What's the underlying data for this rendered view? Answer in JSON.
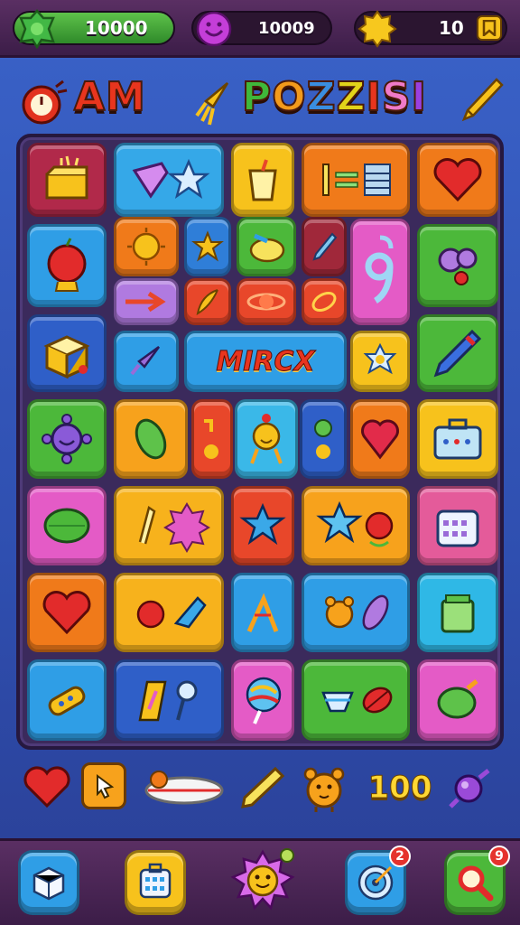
{
  "resources": {
    "gems": {
      "value": "10000",
      "icon": "green-gem-icon",
      "color": "#3fae3a"
    },
    "lives": {
      "value": "10009",
      "icon": "purple-smiley-icon",
      "color": "#b03fd0"
    },
    "coins": {
      "value": "10",
      "icon": "gold-star-coin-icon",
      "color": "#f5c518"
    }
  },
  "title": {
    "word1": "AM",
    "word2": "POZZISI",
    "word1_color": "#e8351e",
    "word2_colors": [
      "#3fb83a",
      "#f29a1b",
      "#3a8ee0",
      "#e2d31a",
      "#e8351e",
      "#f07ac8",
      "#9b3fe0"
    ]
  },
  "board": {
    "special_tile": {
      "label": "MIRCX"
    }
  },
  "tray": {
    "count": "100"
  },
  "nav": {
    "items": [
      {
        "name": "box",
        "icon": "white-box-icon",
        "badge": ""
      },
      {
        "name": "calendar",
        "icon": "calendar-icon",
        "badge": ""
      },
      {
        "name": "sun",
        "icon": "smiling-sun-icon",
        "badge": ""
      },
      {
        "name": "target",
        "icon": "target-icon",
        "badge": "2"
      },
      {
        "name": "search",
        "icon": "search-icon",
        "badge": "9"
      }
    ]
  },
  "colors": {
    "red": "#e8472a",
    "blue": "#2f9ee6",
    "yellow": "#f7c21c",
    "orange": "#f27a1a",
    "green": "#4cb83a",
    "purple": "#9a6ad8",
    "pink": "#e45bc6",
    "maroon": "#a0283a",
    "darkblue": "#2f5fc8"
  }
}
